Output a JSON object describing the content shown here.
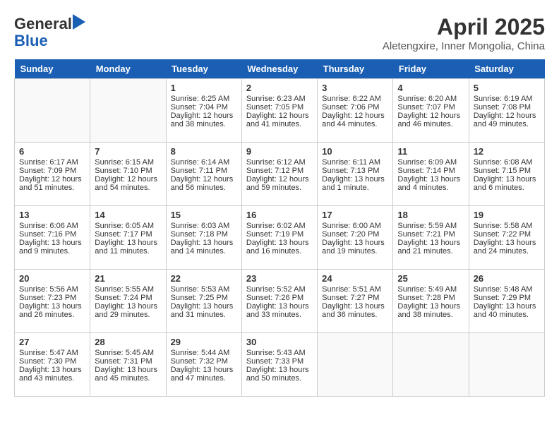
{
  "header": {
    "logo_general": "General",
    "logo_blue": "Blue",
    "month_title": "April 2025",
    "subtitle": "Aletengxire, Inner Mongolia, China"
  },
  "weekdays": [
    "Sunday",
    "Monday",
    "Tuesday",
    "Wednesday",
    "Thursday",
    "Friday",
    "Saturday"
  ],
  "weeks": [
    [
      {
        "day": "",
        "content": ""
      },
      {
        "day": "",
        "content": ""
      },
      {
        "day": "1",
        "content": "Sunrise: 6:25 AM\nSunset: 7:04 PM\nDaylight: 12 hours\nand 38 minutes."
      },
      {
        "day": "2",
        "content": "Sunrise: 6:23 AM\nSunset: 7:05 PM\nDaylight: 12 hours\nand 41 minutes."
      },
      {
        "day": "3",
        "content": "Sunrise: 6:22 AM\nSunset: 7:06 PM\nDaylight: 12 hours\nand 44 minutes."
      },
      {
        "day": "4",
        "content": "Sunrise: 6:20 AM\nSunset: 7:07 PM\nDaylight: 12 hours\nand 46 minutes."
      },
      {
        "day": "5",
        "content": "Sunrise: 6:19 AM\nSunset: 7:08 PM\nDaylight: 12 hours\nand 49 minutes."
      }
    ],
    [
      {
        "day": "6",
        "content": "Sunrise: 6:17 AM\nSunset: 7:09 PM\nDaylight: 12 hours\nand 51 minutes."
      },
      {
        "day": "7",
        "content": "Sunrise: 6:15 AM\nSunset: 7:10 PM\nDaylight: 12 hours\nand 54 minutes."
      },
      {
        "day": "8",
        "content": "Sunrise: 6:14 AM\nSunset: 7:11 PM\nDaylight: 12 hours\nand 56 minutes."
      },
      {
        "day": "9",
        "content": "Sunrise: 6:12 AM\nSunset: 7:12 PM\nDaylight: 12 hours\nand 59 minutes."
      },
      {
        "day": "10",
        "content": "Sunrise: 6:11 AM\nSunset: 7:13 PM\nDaylight: 13 hours\nand 1 minute."
      },
      {
        "day": "11",
        "content": "Sunrise: 6:09 AM\nSunset: 7:14 PM\nDaylight: 13 hours\nand 4 minutes."
      },
      {
        "day": "12",
        "content": "Sunrise: 6:08 AM\nSunset: 7:15 PM\nDaylight: 13 hours\nand 6 minutes."
      }
    ],
    [
      {
        "day": "13",
        "content": "Sunrise: 6:06 AM\nSunset: 7:16 PM\nDaylight: 13 hours\nand 9 minutes."
      },
      {
        "day": "14",
        "content": "Sunrise: 6:05 AM\nSunset: 7:17 PM\nDaylight: 13 hours\nand 11 minutes."
      },
      {
        "day": "15",
        "content": "Sunrise: 6:03 AM\nSunset: 7:18 PM\nDaylight: 13 hours\nand 14 minutes."
      },
      {
        "day": "16",
        "content": "Sunrise: 6:02 AM\nSunset: 7:19 PM\nDaylight: 13 hours\nand 16 minutes."
      },
      {
        "day": "17",
        "content": "Sunrise: 6:00 AM\nSunset: 7:20 PM\nDaylight: 13 hours\nand 19 minutes."
      },
      {
        "day": "18",
        "content": "Sunrise: 5:59 AM\nSunset: 7:21 PM\nDaylight: 13 hours\nand 21 minutes."
      },
      {
        "day": "19",
        "content": "Sunrise: 5:58 AM\nSunset: 7:22 PM\nDaylight: 13 hours\nand 24 minutes."
      }
    ],
    [
      {
        "day": "20",
        "content": "Sunrise: 5:56 AM\nSunset: 7:23 PM\nDaylight: 13 hours\nand 26 minutes."
      },
      {
        "day": "21",
        "content": "Sunrise: 5:55 AM\nSunset: 7:24 PM\nDaylight: 13 hours\nand 29 minutes."
      },
      {
        "day": "22",
        "content": "Sunrise: 5:53 AM\nSunset: 7:25 PM\nDaylight: 13 hours\nand 31 minutes."
      },
      {
        "day": "23",
        "content": "Sunrise: 5:52 AM\nSunset: 7:26 PM\nDaylight: 13 hours\nand 33 minutes."
      },
      {
        "day": "24",
        "content": "Sunrise: 5:51 AM\nSunset: 7:27 PM\nDaylight: 13 hours\nand 36 minutes."
      },
      {
        "day": "25",
        "content": "Sunrise: 5:49 AM\nSunset: 7:28 PM\nDaylight: 13 hours\nand 38 minutes."
      },
      {
        "day": "26",
        "content": "Sunrise: 5:48 AM\nSunset: 7:29 PM\nDaylight: 13 hours\nand 40 minutes."
      }
    ],
    [
      {
        "day": "27",
        "content": "Sunrise: 5:47 AM\nSunset: 7:30 PM\nDaylight: 13 hours\nand 43 minutes."
      },
      {
        "day": "28",
        "content": "Sunrise: 5:45 AM\nSunset: 7:31 PM\nDaylight: 13 hours\nand 45 minutes."
      },
      {
        "day": "29",
        "content": "Sunrise: 5:44 AM\nSunset: 7:32 PM\nDaylight: 13 hours\nand 47 minutes."
      },
      {
        "day": "30",
        "content": "Sunrise: 5:43 AM\nSunset: 7:33 PM\nDaylight: 13 hours\nand 50 minutes."
      },
      {
        "day": "",
        "content": ""
      },
      {
        "day": "",
        "content": ""
      },
      {
        "day": "",
        "content": ""
      }
    ]
  ]
}
